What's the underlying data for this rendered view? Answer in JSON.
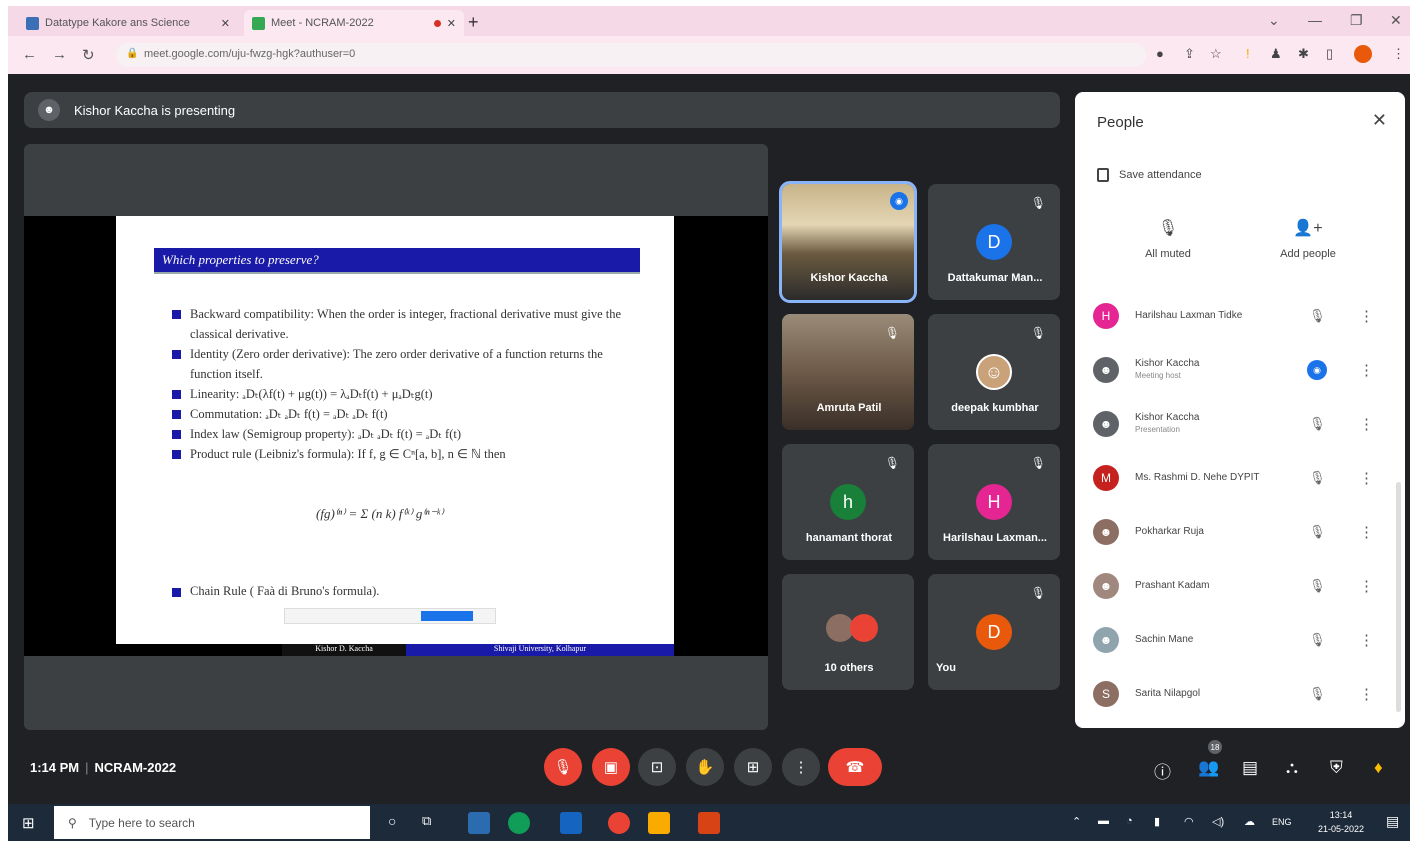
{
  "browser": {
    "tabs": [
      {
        "title": "Datatype Kakore ans Science"
      },
      {
        "title": "Meet - NCRAM-2022"
      }
    ],
    "url": "meet.google.com/uju-fwzg-hgk?authuser=0"
  },
  "presenting": {
    "text": "Kishor Kaccha is presenting"
  },
  "slide": {
    "title": "Which properties to preserve?",
    "bullets": [
      "Backward compatibility: When the order is integer, fractional derivative must give the classical derivative.",
      "Identity (Zero order derivative): The zero order derivative of a function returns the function itself.",
      "Linearity: ₐDₜ(λf(t) + μg(t)) = λₐDₜf(t) + μₐDₜg(t)",
      "Commutation: ₐDₜ ₐDₜ f(t) = ₐDₜ ₐDₜ f(t)",
      "Index law (Semigroup property): ₐDₜ ₐDₜ f(t) = ₐDₜ f(t)",
      "Product rule (Leibniz's formula): If f, g ∈ Cⁿ[a, b], n ∈ ℕ then"
    ],
    "formula": "(fg)⁽ⁿ⁾ = Σ (n k) f⁽ᵏ⁾ g⁽ⁿ⁻ᵏ⁾",
    "chain": "Chain Rule ( Faà di Bruno's formula).",
    "footer_left": "Kishor D. Kaccha",
    "footer_right": "Shivaji University, Kolhapur"
  },
  "tiles": [
    {
      "name": "Kishor Kaccha",
      "kind": "video"
    },
    {
      "name": "Dattakumar Man...",
      "initial": "D",
      "color": "#1a73e8"
    },
    {
      "name": "Amruta Patil",
      "kind": "video"
    },
    {
      "name": "deepak kumbhar",
      "kind": "avatar"
    },
    {
      "name": "hanamant thorat",
      "initial": "h",
      "color": "#188038"
    },
    {
      "name": "Harilshau Laxman...",
      "initial": "H",
      "color": "#e52592"
    },
    {
      "name": "10 others"
    },
    {
      "name": "You",
      "initial": "D",
      "color": "#e8590c"
    }
  ],
  "people": {
    "title": "People",
    "save_attendance": "Save attendance",
    "all_muted": "All muted",
    "add_people": "Add people",
    "rows": [
      {
        "name": "Harilshau Laxman Tidke",
        "initial": "H",
        "color": "#e52592"
      },
      {
        "name": "Kishor Kaccha",
        "sub": "Meeting host",
        "color": "#5f6368"
      },
      {
        "name": "Kishor Kaccha",
        "sub": "Presentation",
        "color": "#5f6368"
      },
      {
        "name": "Ms. Rashmi D. Nehe DYPIT",
        "initial": "M",
        "color": "#c5221f"
      },
      {
        "name": "Pokharkar Ruja",
        "color": "#8d6e63"
      },
      {
        "name": "Prashant Kadam",
        "color": "#a1887f"
      },
      {
        "name": "Sachin Mane",
        "color": "#90a4ae"
      },
      {
        "name": "Sarita Nilapgol",
        "color": "#8d6e63"
      }
    ]
  },
  "bottom": {
    "time": "1:14 PM",
    "meeting": "NCRAM-2022",
    "participants_badge": "18"
  },
  "taskbar": {
    "search": "Type here to search",
    "time": "13:14",
    "date": "21-05-2022",
    "lang": "ENG"
  }
}
